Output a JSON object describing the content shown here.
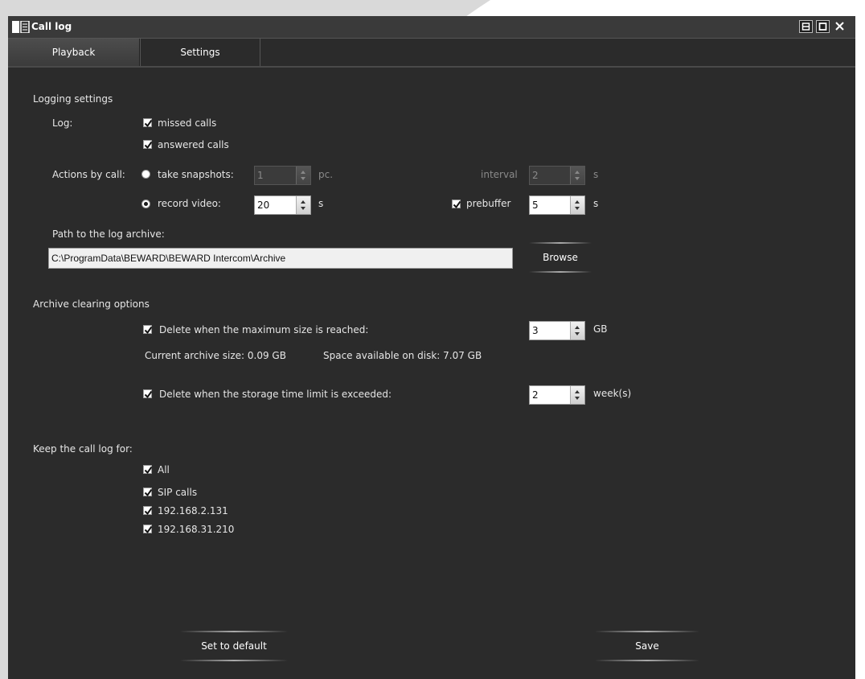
{
  "window": {
    "title": "Call log"
  },
  "tabs": [
    {
      "label": "Playback"
    },
    {
      "label": "Settings"
    }
  ],
  "logging": {
    "heading": "Logging settings",
    "log_label": "Log:",
    "missed_calls": "missed calls",
    "answered_calls": "answered calls",
    "actions_label": "Actions by call:",
    "take_snapshots": "take snapshots:",
    "snapshots_value": "1",
    "snapshots_unit": "pc.",
    "interval_label": "interval",
    "interval_value": "2",
    "interval_unit": "s",
    "record_video": "record video:",
    "video_value": "20",
    "video_unit": "s",
    "prebuffer_label": "prebuffer",
    "prebuffer_value": "5",
    "prebuffer_unit": "s",
    "path_label": "Path to the log archive:",
    "path_value": "C:\\ProgramData\\BEWARD\\BEWARD Intercom\\Archive",
    "browse": "Browse"
  },
  "archive": {
    "heading": "Archive clearing options",
    "max_size_label": "Delete when the maximum size is reached:",
    "max_size_value": "3",
    "max_size_unit": "GB",
    "current_size": "Current archive size:  0.09 GB",
    "space_available": "Space available on disk:  7.07 GB",
    "time_limit_label": "Delete when the storage time limit is exceeded:",
    "time_limit_value": "2",
    "time_limit_unit": "week(s)"
  },
  "keep": {
    "heading": "Keep the call log for:",
    "items": [
      {
        "label": "All"
      },
      {
        "label": "SIP calls"
      },
      {
        "label": "192.168.2.131"
      },
      {
        "label": "192.168.31.210"
      }
    ]
  },
  "footer": {
    "default_button": "Set to default",
    "save_button": "Save"
  }
}
